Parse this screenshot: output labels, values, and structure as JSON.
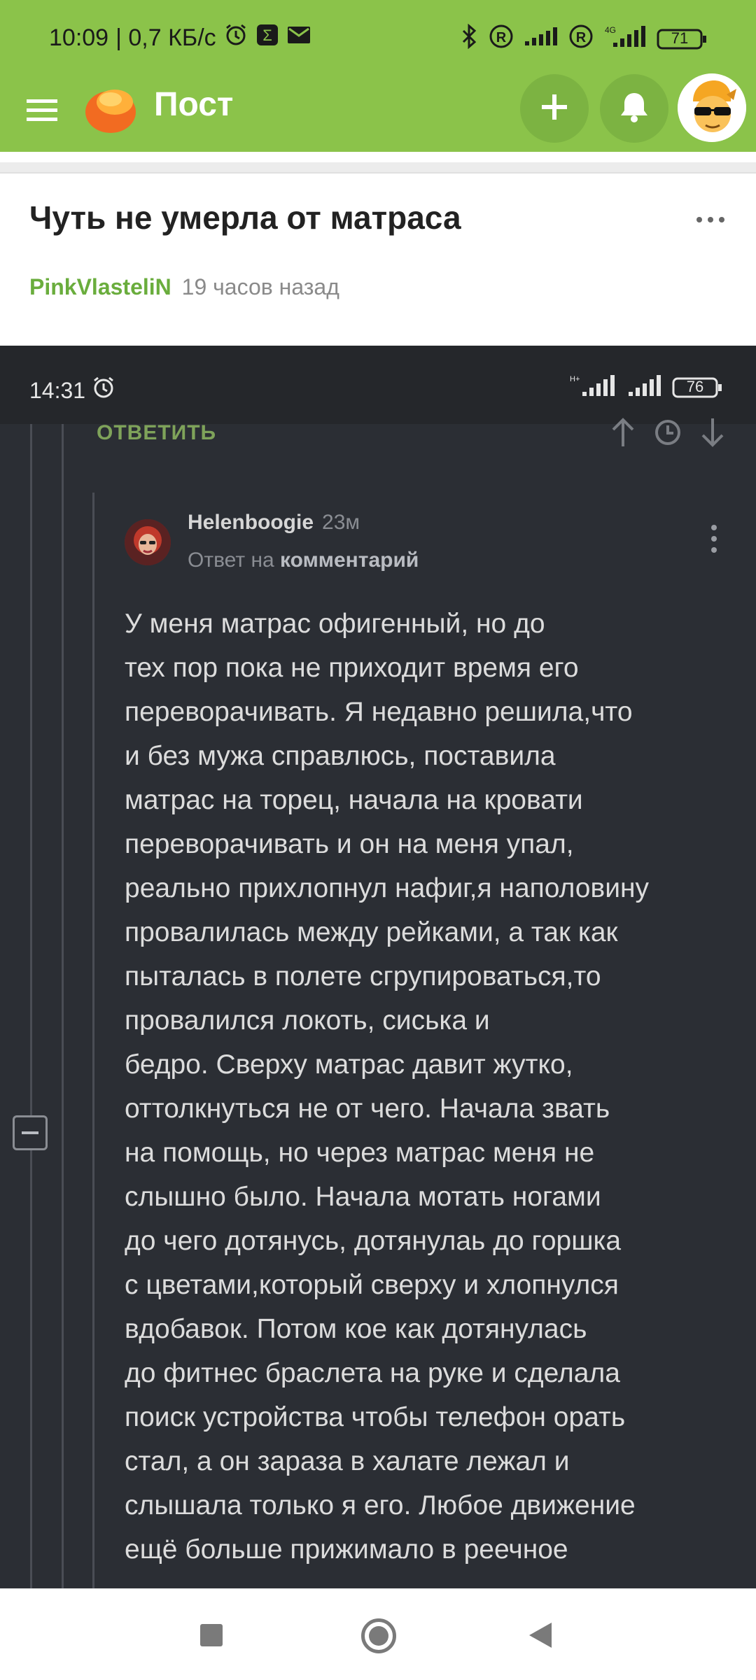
{
  "status_bar": {
    "time": "10:09",
    "speed": "| 0,7 КБ/с",
    "battery": "71",
    "icons": [
      "alarm-icon",
      "app-notification-icon",
      "mail-icon",
      "bluetooth-icon",
      "roaming-icon",
      "signal-icon",
      "roaming-icon",
      "signal-icon",
      "battery-icon"
    ]
  },
  "app_bar": {
    "title": "Пост",
    "add_icon": "plus-icon",
    "bell_icon": "bell-icon"
  },
  "post": {
    "title": "Чуть не умерла от матраса",
    "author": "PinkVlasteliN",
    "time_ago": "19 часов назад"
  },
  "screenshot": {
    "status_time": "14:31",
    "battery": "76",
    "reply_label": "ОТВЕТИТЬ",
    "comment": {
      "username": "Helenboogie",
      "ago": "23м",
      "reply_prefix": "Ответ на",
      "reply_target": "комментарий",
      "lines": [
        "У меня матрас офигенный, но до",
        "тех пор пока не приходит время его",
        "переворачивать. Я недавно решила,что",
        "и без мужа справлюсь, поставила",
        "матрас на торец, начала на кровати",
        "переворачивать и он на меня упал,",
        "реально прихлопнул нафиг,я наполовину",
        "провалилась между рейками, а так как",
        "пыталась в полете сгрупироваться,то",
        "провалился локоть, сиська и",
        "бедро. Сверху матрас давит жутко,",
        "оттолкнуться не от чего. Начала звать",
        "на помощь, но через матрас меня не",
        "слышно было. Начала мотать ногами",
        "до чего дотянусь, дотянулаь до горшка",
        "с цветами,который сверху и хлопнулся",
        "вдобавок. Потом кое как дотянулась",
        "до фитнес браслета на руке и сделала",
        "поиск устройства чтобы телефон орать",
        "стал, а он зараза в халате лежал и",
        "слышала только я его. Любое движение",
        "ещё больше прижимало в реечное"
      ]
    }
  },
  "colors": {
    "header_green": "#8bc34a",
    "author_green": "#6aad3d",
    "dark_bg": "#2b2e34"
  }
}
